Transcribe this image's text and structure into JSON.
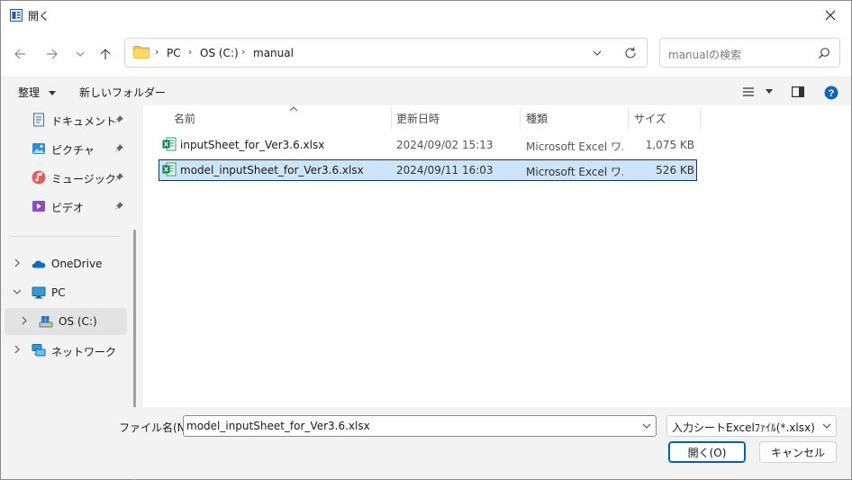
{
  "window": {
    "title": "開く",
    "accent": "#005fb8"
  },
  "nav": {
    "back_icon": "back-arrow-icon",
    "forward_icon": "forward-arrow-icon",
    "recent_icon": "chevron-down-icon",
    "up_icon": "up-arrow-icon"
  },
  "address": {
    "crumbs": [
      "PC",
      "OS (C:)",
      "manual"
    ]
  },
  "search": {
    "placeholder": "manualの検索"
  },
  "toolbar": {
    "organize": "整理",
    "new_folder": "新しいフォルダー"
  },
  "sidebar": {
    "quick": [
      {
        "label": "ドキュメント",
        "icon": "documents-icon"
      },
      {
        "label": "ピクチャ",
        "icon": "pictures-icon"
      },
      {
        "label": "ミュージック",
        "icon": "music-icon"
      },
      {
        "label": "ビデオ",
        "icon": "videos-icon"
      }
    ],
    "tree": [
      {
        "label": "OneDrive",
        "icon": "onedrive-icon"
      },
      {
        "label": "PC",
        "icon": "pc-icon"
      },
      {
        "label": "OS (C:)",
        "icon": "drive-icon"
      },
      {
        "label": "ネットワーク",
        "icon": "network-icon"
      }
    ]
  },
  "columns": {
    "name": "名前",
    "date": "更新日時",
    "type": "種類",
    "size": "サイズ"
  },
  "files": [
    {
      "name": "inputSheet_for_Ver3.6.xlsx",
      "date": "2024/09/02 15:13",
      "type": "Microsoft Excel ワ...",
      "size": "1,075 KB",
      "selected": false
    },
    {
      "name": "model_inputSheet_for_Ver3.6.xlsx",
      "date": "2024/09/11 16:03",
      "type": "Microsoft Excel ワ...",
      "size": "526 KB",
      "selected": true
    }
  ],
  "footer": {
    "filename_label": "ファイル名(N):",
    "filename_value": "model_inputSheet_for_Ver3.6.xlsx",
    "filetype_value": "入力シートExcelﾌｧｲﾙ(*.xlsx)",
    "open_label": "開く(O)",
    "cancel_label": "キャンセル"
  }
}
